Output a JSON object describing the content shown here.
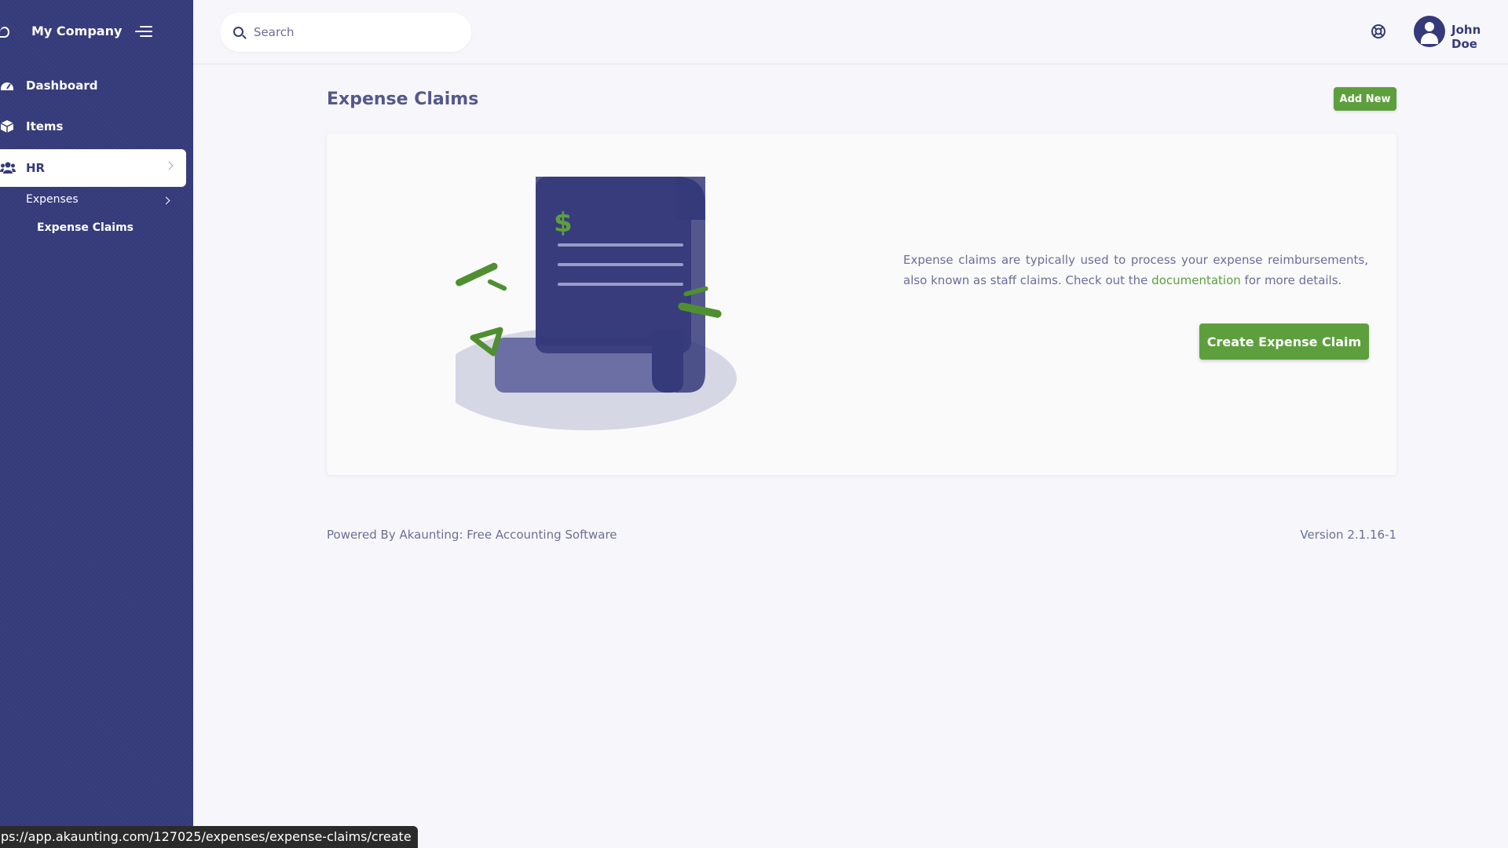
{
  "sidebar": {
    "company_name": "My Company",
    "items": [
      {
        "label": "Dashboard",
        "icon": "dashboard-icon"
      },
      {
        "label": "Items",
        "icon": "cube-icon"
      },
      {
        "label": "HR",
        "icon": "users-icon"
      }
    ],
    "submenu": {
      "expenses_label": "Expenses",
      "expense_claims_label": "Expense Claims"
    }
  },
  "topbar": {
    "search_placeholder": "Search",
    "user_name": "John Doe"
  },
  "main": {
    "title": "Expense Claims",
    "add_new_label": "Add New",
    "description_before": "Expense claims are typically used to process your expense reimbursements, also known as staff claims. Check out the ",
    "documentation_link": "documentation",
    "description_after": " for more details.",
    "create_button_label": "Create Expense Claim"
  },
  "footer": {
    "powered_by": "Powered By ",
    "powered_link": "Akaunting: Free Accounting Software",
    "version": "Version 2.1.16-1"
  },
  "status_bar": {
    "url": "ps://app.akaunting.com/127025/expenses/expense-claims/create"
  },
  "colors": {
    "sidebar_bg": "#353a7a",
    "accent_green": "#5d9f3d",
    "text_muted": "#6b6e98"
  }
}
